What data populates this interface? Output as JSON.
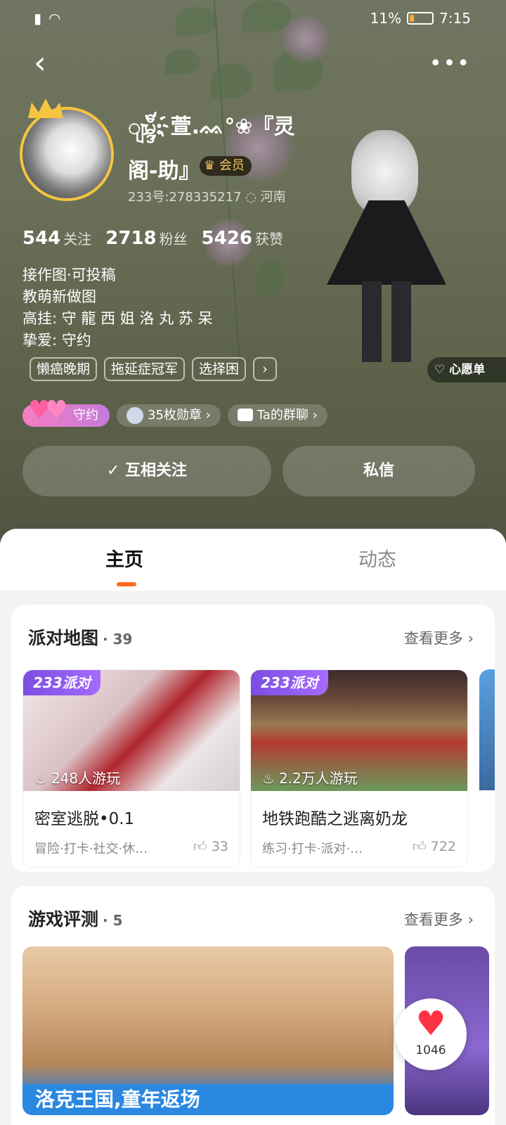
{
  "status_bar": {
    "battery_percent": "11%",
    "time": "7:15"
  },
  "header": {
    "back_icon": "chevron-left-icon",
    "more_icon": "more-dots-icon"
  },
  "profile": {
    "name_line1": "ျမ္ဒီး҉萱.ᨐ°❀『灵",
    "name_line2": "阁-助』",
    "vip_label": "会员",
    "uid": "233号:278335217",
    "location": "河南",
    "stats": [
      {
        "value": "544",
        "label": "关注"
      },
      {
        "value": "2718",
        "label": "粉丝"
      },
      {
        "value": "5426",
        "label": "获赞"
      }
    ],
    "bio_lines": [
      "接作图·可投稿",
      "教萌新做图",
      "高挂: 守 龍 西 姐 洛 丸 苏 呆",
      "挚爱: 守约"
    ],
    "tags": [
      "懒癌晚期",
      "拖延症冠军",
      "选择困"
    ],
    "wishlist_label": "心愿单",
    "couple_label": "守约",
    "medals_label": "35枚勋章",
    "group_chat_label": "Ta的群聊"
  },
  "actions": {
    "follow_label": "互相关注",
    "message_label": "私信"
  },
  "tabs": [
    {
      "label": "主页"
    },
    {
      "label": "动态"
    }
  ],
  "party_maps": {
    "title": "派对地图",
    "count": "· 39",
    "see_more": "查看更多",
    "items": [
      {
        "logo": "233派对",
        "plays": "248人游玩",
        "title": "密室逃脱•0.1",
        "meta": "冒险·打卡·社交·休…",
        "likes": "33"
      },
      {
        "logo": "233派对",
        "plays": "2.2万人游玩",
        "title": "地铁跑酷之逃离奶龙",
        "meta": "练习·打卡·派对·…",
        "likes": "722"
      }
    ]
  },
  "game_reviews": {
    "title": "游戏评测",
    "count": "· 5",
    "see_more": "查看更多",
    "banner": "洛克王国,童年返场"
  },
  "like_fab": {
    "count": "1046"
  }
}
